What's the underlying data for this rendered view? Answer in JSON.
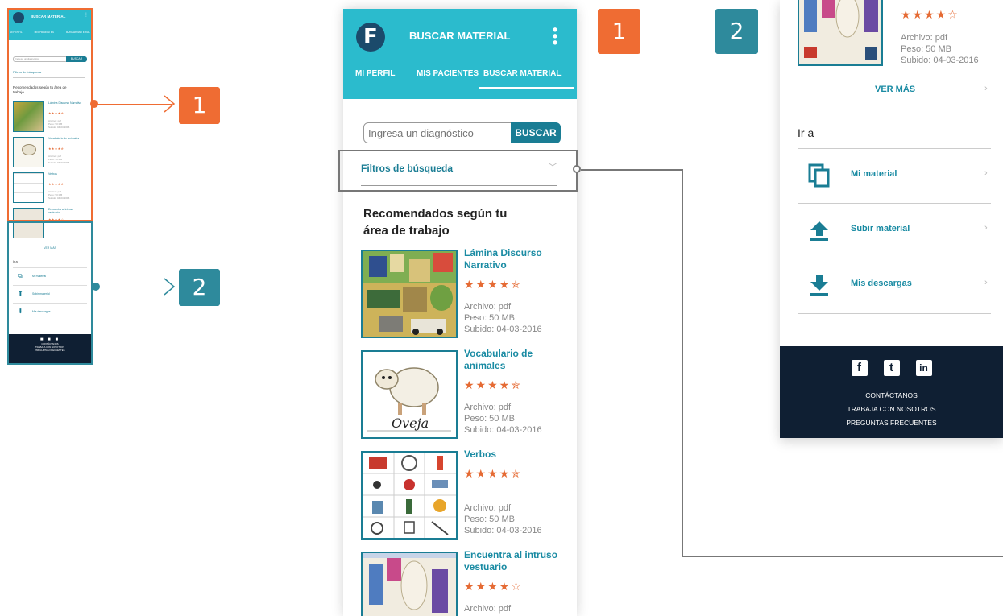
{
  "app": {
    "title": "BUSCAR MATERIAL",
    "logo_letter": "F",
    "menu_icon": "kebab-menu-icon"
  },
  "tabs": [
    "MI PERFIL",
    "MIS PACIENTES",
    "BUSCAR MATERIAL"
  ],
  "search": {
    "placeholder": "Ingresa un diagnóstico",
    "button": "BUSCAR"
  },
  "filters": {
    "label": "Filtros de búsqueda"
  },
  "recommended": {
    "heading": "Recomendados según tu área de trabajo",
    "items": [
      {
        "name": "Lámina Discurso Narrativo",
        "rating": 4.5,
        "stars": "★★★★✯",
        "file": "Archivo: pdf",
        "size": "Peso: 50 MB",
        "uploaded": "Subido: 04-03-2016"
      },
      {
        "name": "Vocabulario de animales",
        "rating": 4.5,
        "stars": "★★★★✯",
        "file": "Archivo: pdf",
        "size": "Peso: 50 MB",
        "uploaded": "Subido: 04-03-2016",
        "thumb_caption": "Oveja"
      },
      {
        "name": "Verbos",
        "rating": 4.5,
        "stars": "★★★★✯",
        "file": "Archivo: pdf",
        "size": "Peso: 50 MB",
        "uploaded": "Subido: 04-03-2016"
      },
      {
        "name": "Encuentra al intruso vestuario",
        "rating": 4,
        "stars": "★★★★☆",
        "file": "Archivo: pdf",
        "size": "Peso: 50 MB",
        "uploaded": "Subido: 04-03-2016"
      }
    ]
  },
  "ver_mas": "VER MÁS",
  "go_to": {
    "heading": "Ir a",
    "items": [
      {
        "label": "Mi material",
        "icon": "copy-icon"
      },
      {
        "label": "Subir material",
        "icon": "upload-icon"
      },
      {
        "label": "Mis descargas",
        "icon": "download-icon"
      }
    ]
  },
  "footer": {
    "social": [
      "f",
      "t",
      "in"
    ],
    "links": [
      "CONTÁCTANOS",
      "TRABAJA CON NOSOTROS",
      "PREGUNTAS FRECUENTES"
    ]
  },
  "callouts": [
    {
      "number": "1",
      "color": "#ef6c33"
    },
    {
      "number": "2",
      "color": "#2e8a9c"
    }
  ],
  "colors": {
    "header": "#2bbbcd",
    "accent": "#1a7d94",
    "stars": "#e56a33",
    "footer": "#0f1f33"
  }
}
